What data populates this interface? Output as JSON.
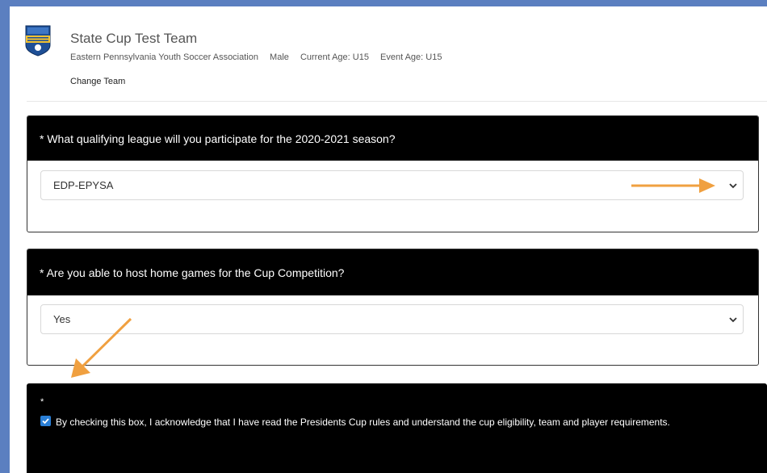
{
  "team": {
    "name": "State Cup Test Team",
    "association": "Eastern Pennsylvania Youth Soccer Association",
    "gender": "Male",
    "current_age": "Current Age: U15",
    "event_age": "Event Age: U15",
    "change_link": "Change Team",
    "logo_icon": "epysa-shield-logo"
  },
  "questions": [
    {
      "label": "* What qualifying league will you participate for the 2020-2021 season?",
      "selected": "EDP-EPYSA"
    },
    {
      "label": "* Are you able to host home games for the Cup Competition?",
      "selected": "Yes"
    }
  ],
  "acknowledgement": {
    "required_mark": "*",
    "checked": true,
    "text": "By checking this box, I acknowledge that I have read the Presidents Cup rules and understand the cup eligibility, team and player requirements."
  },
  "colors": {
    "frame": "#5b7fc0",
    "card_header": "#000000",
    "checkbox": "#2a7fd6",
    "annotation_arrow": "#f0a040"
  }
}
